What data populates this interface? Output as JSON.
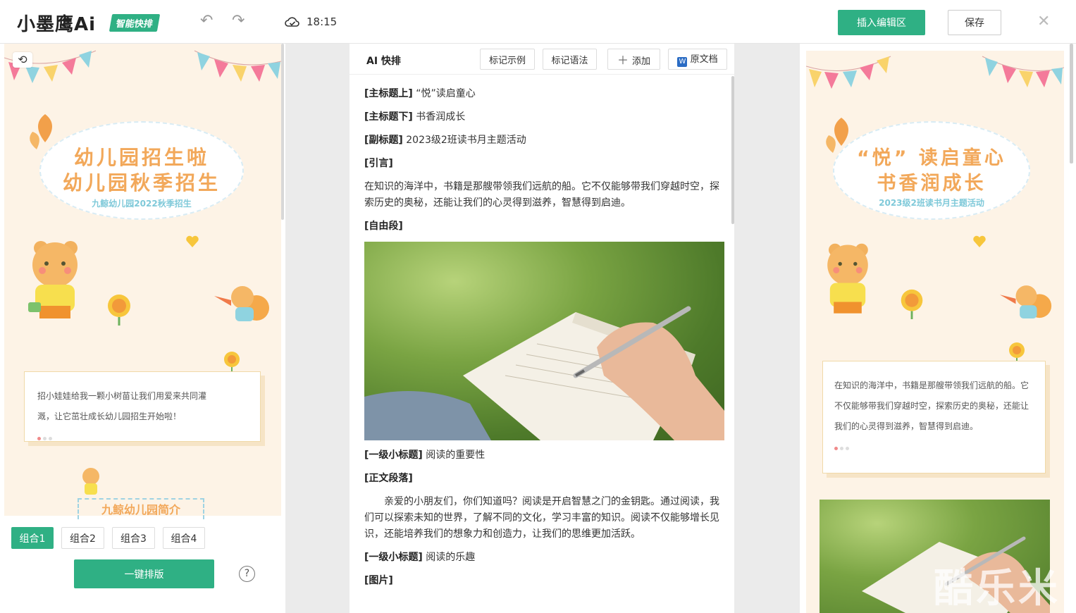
{
  "header": {
    "logo": "小墨鹰Ai",
    "logo_badge": "智能快排",
    "save_time": "18:15",
    "insert_label": "插入编辑区",
    "save_label": "保存"
  },
  "left": {
    "poster_title_1": "幼儿园招生啦",
    "poster_title_2": "幼儿园秋季招生",
    "poster_sub": "九鲸幼儿园2022秋季招生",
    "card_text_1": "招小娃娃给我一颗小树苗让我们用爱来共同灌",
    "card_text_2": "溉，让它茁壮成长幼儿园招生开始啦！",
    "mini_banner": "九鲸幼儿园简介",
    "groups": [
      "组合1",
      "组合2",
      "组合3",
      "组合4"
    ],
    "onekey_label": "一键排版",
    "help": "?"
  },
  "middle": {
    "title": "AI 快排",
    "btn_example": "标记示例",
    "btn_syntax": "标记语法",
    "btn_add": "添加",
    "btn_original": "原文档",
    "rows": [
      {
        "tag": "[主标题上]",
        "text": "“悦”读启童心"
      },
      {
        "tag": "[主标题下]",
        "text": "书香润成长"
      },
      {
        "tag": "[副标题]",
        "text": "2023级2班读书月主题活动"
      },
      {
        "tag": "[引言]",
        "text": ""
      }
    ],
    "intro": "在知识的海洋中，书籍是那艘带领我们远航的船。它不仅能够带我们穿越时空，探索历史的奥秘，还能让我们的心灵得到滋养，智慧得到启迪。",
    "free_tag": "[自由段]",
    "h1_tag": "[一级小标题]",
    "h1_text": "阅读的重要性",
    "body_tag": "[正文段落]",
    "body_text": "亲爱的小朋友们，你们知道吗？阅读是开启智慧之门的金钥匙。通过阅读，我们可以探索未知的世界，了解不同的文化，学习丰富的知识。阅读不仅能够增长见识，还能培养我们的想象力和创造力，让我们的思维更加活跃。",
    "h1b_tag": "[一级小标题]",
    "h1b_text": "阅读的乐趣",
    "img_tag": "[图片]"
  },
  "right": {
    "poster_title_1": "“悦” 读启童心",
    "poster_title_2": "书香润成长",
    "poster_sub": "2023级2班读书月主题活动",
    "card_text": "在知识的海洋中，书籍是那艘带领我们远航的船。它不仅能够带我们穿越时空，探索历史的奥秘，还能让我们的心灵得到滋养，智慧得到启迪。",
    "watermark": "酷乐米"
  },
  "colors": {
    "accent": "#2fb084",
    "poster_bg": "#fdf3e6",
    "title_orange": "#f2a85a",
    "sub_teal": "#7fc9d9"
  }
}
